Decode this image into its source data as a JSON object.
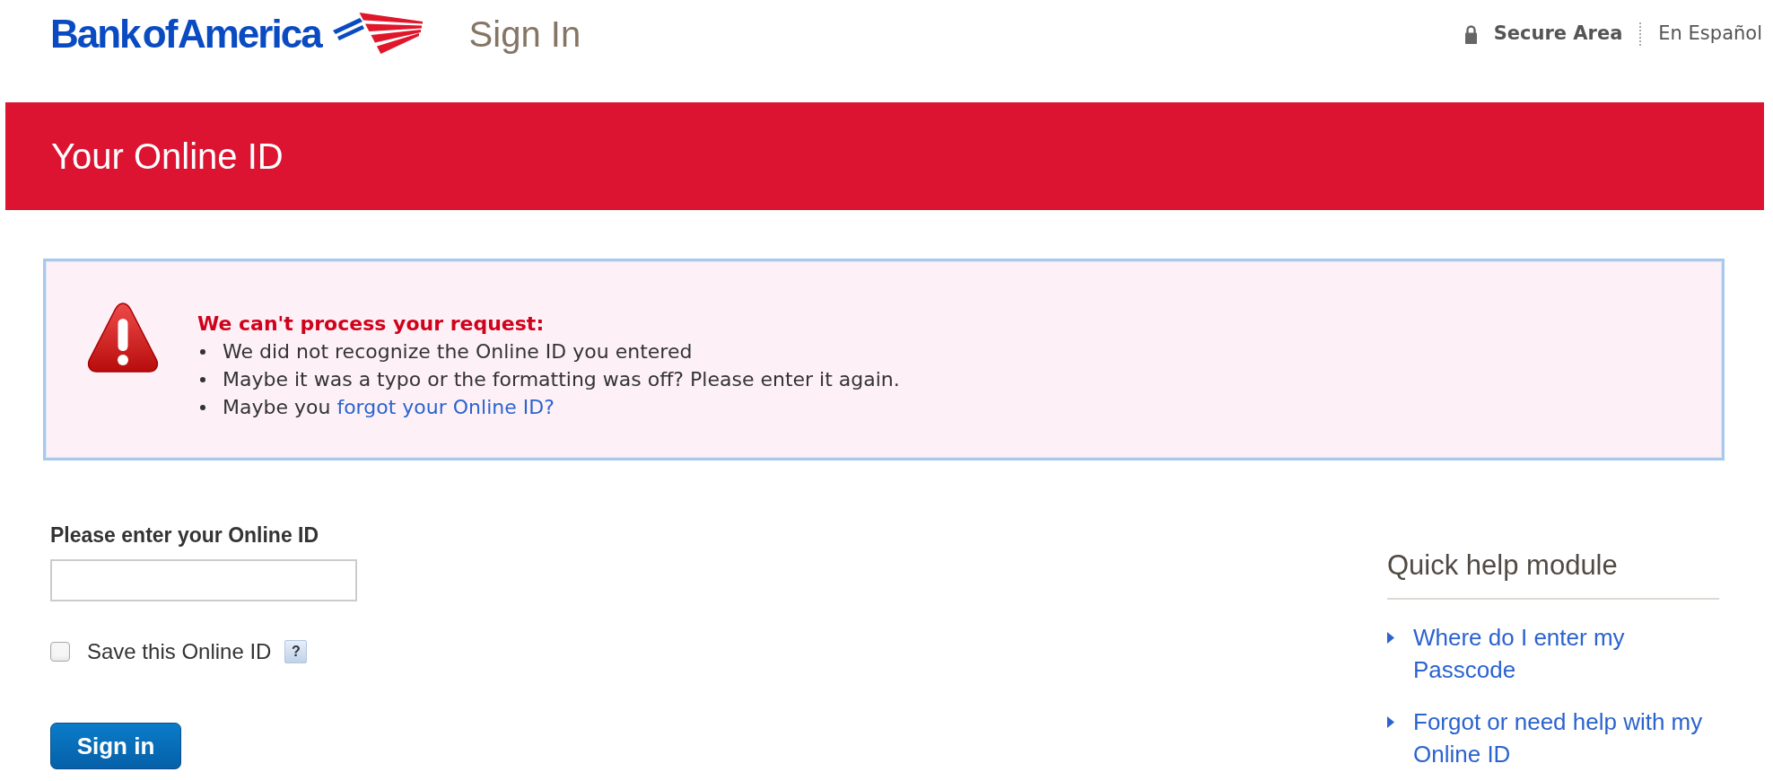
{
  "header": {
    "brand": "Bank of America",
    "page_title": "Sign In",
    "secure_label": "Secure Area",
    "language_link": "En Español"
  },
  "banner": {
    "title": "Your Online ID"
  },
  "alert": {
    "title": "We can't process your request:",
    "items": [
      {
        "text": "We did not recognize the Online ID you entered"
      },
      {
        "text": "Maybe it was a typo or the formatting was off? Please enter it again."
      },
      {
        "text": "Maybe you",
        "link": "forgot your Online ID?"
      }
    ]
  },
  "form": {
    "label": "Please enter your Online ID",
    "save_id": {
      "label": "Save this Online ID",
      "checked": false,
      "help": "?"
    },
    "submit": "Sign in"
  },
  "quick_help": {
    "title": "Quick help module",
    "links": [
      "Where do I enter my Passcode",
      "Forgot or need help with my Online ID"
    ]
  }
}
